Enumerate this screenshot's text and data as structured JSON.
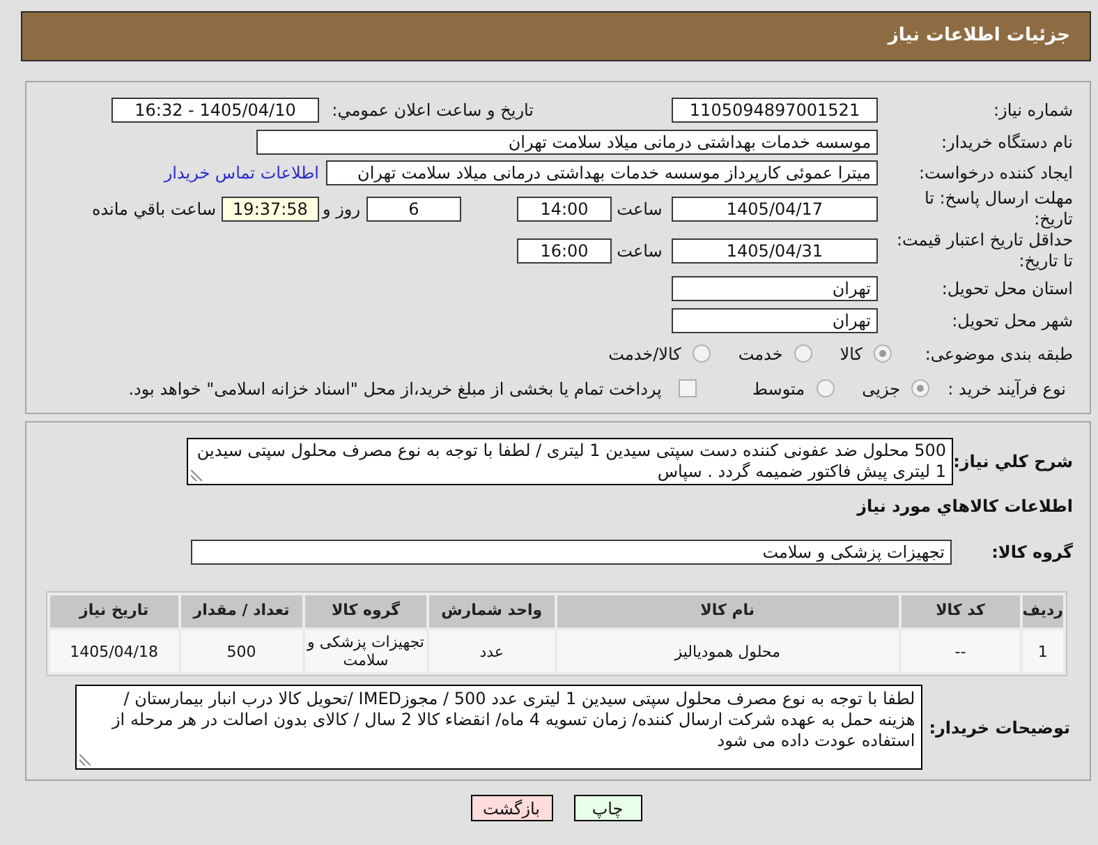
{
  "header": {
    "title": "جزئیات اطلاعات نیاز"
  },
  "details": {
    "need_number": {
      "label": "شماره نیاز:",
      "value": "1105094897001521"
    },
    "announce": {
      "label": "تاریخ و ساعت اعلان عمومي:",
      "value": "1405/04/10 - 16:32"
    },
    "buyer_org": {
      "label": "نام دستگاه خریدار:",
      "value": "موسسه خدمات بهداشتی درمانی میلاد سلامت تهران"
    },
    "creator": {
      "label": "ایجاد کننده درخواست:",
      "value": "میترا عموئی کارپرداز موسسه خدمات بهداشتی درمانی میلاد سلامت تهران",
      "contact_link": "اطلاعات تماس خریدار"
    },
    "reply_deadline": {
      "label": "مهلت ارسال پاسخ: تا تاریخ:",
      "date": "1405/04/17",
      "time_label": "ساعت",
      "time": "14:00",
      "days": "6",
      "days_label": "روز و",
      "remaining": "19:37:58",
      "remaining_label": "ساعت باقي مانده"
    },
    "price_validity": {
      "label": "حداقل تاریخ اعتبار قیمت: تا تاریخ:",
      "date": "1405/04/31",
      "time_label": "ساعت",
      "time": "16:00"
    },
    "province": {
      "label": "استان محل تحویل:",
      "value": "تهران"
    },
    "city": {
      "label": "شهر محل تحویل:",
      "value": "تهران"
    },
    "category": {
      "label": "طبقه بندی موضوعی:",
      "options": [
        {
          "label": "کالا",
          "selected": true
        },
        {
          "label": "خدمت",
          "selected": false
        },
        {
          "label": "کالا/خدمت",
          "selected": false
        }
      ]
    },
    "process": {
      "label": "نوع فرآیند خرید :",
      "options": [
        {
          "label": "جزیی",
          "selected": true
        },
        {
          "label": "متوسط",
          "selected": false
        }
      ],
      "treasury": {
        "label": "پرداخت تمام یا بخشی از مبلغ خرید،از محل \"اسناد خزانه اسلامی\" خواهد بود.",
        "checked": false
      }
    }
  },
  "need": {
    "description": {
      "label": "شرح کلي نیاز:",
      "value": "500 محلول ضد عفونی کننده دست سپتی سیدین 1 لیتری  /  لطفا با توجه به نوع مصرف محلول سپتی سیدین 1 لیتری پیش فاکتور ضمیمه گردد . سپاس"
    },
    "goods_heading": "اطلاعات کالاهاي مورد نياز",
    "goods_group": {
      "label": "گروه کالا:",
      "value": "تجهیزات پزشکی و سلامت"
    },
    "table": {
      "columns": [
        "ردیف",
        "کد کالا",
        "نام کالا",
        "واحد شمارش",
        "گروه کالا",
        "تعداد / مقدار",
        "تاریخ نیاز"
      ],
      "rows": [
        [
          "1",
          "--",
          "محلول همودیالیز",
          "عدد",
          "تجهیزات پزشکی و سلامت",
          "500",
          "1405/04/18"
        ]
      ]
    },
    "buyer_notes": {
      "label": "توضیحات خریدار:",
      "value": "لطفا با توجه به نوع مصرف محلول سپتی سیدین 1 لیتری عدد 500  /  مجوزIMED /تحویل کالا درب انبار بیمارستان / هزینه حمل به عهده شرکت ارسال کننده/ زمان تسویه 4 ماه/ انقضاء کالا 2 سال / کالای بدون اصالت در هر مرحله از استفاده عودت داده می شود"
    }
  },
  "buttons": [
    {
      "label": "چاپ",
      "kind": "print"
    },
    {
      "label": "بازگشت",
      "kind": "back"
    }
  ]
}
